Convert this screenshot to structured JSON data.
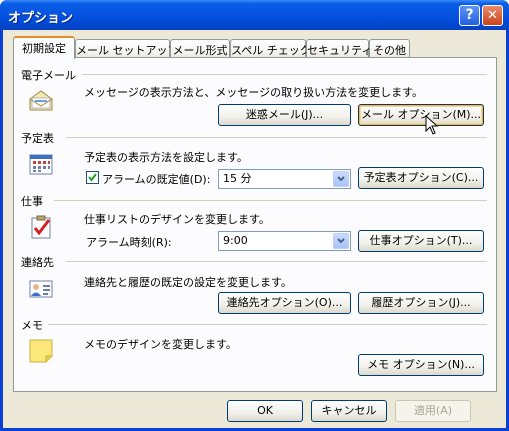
{
  "window": {
    "title": "オプション",
    "help_label": "?",
    "close_label": "✕"
  },
  "tabs": [
    {
      "label": "初期設定",
      "active": true
    },
    {
      "label": "メール セットアップ"
    },
    {
      "label": "メール形式"
    },
    {
      "label": "スペル チェック"
    },
    {
      "label": "セキュリティ"
    },
    {
      "label": "その他"
    }
  ],
  "sections": {
    "email": {
      "heading": "電子メール",
      "description": "メッセージの表示方法と、メッセージの取り扱い方法を変更します。",
      "junk_button": "迷惑メール(J)...",
      "options_button": "メール オプション(M)...",
      "icon": "envelope-icon"
    },
    "calendar": {
      "heading": "予定表",
      "description": "予定表の表示方法を設定します。",
      "reminder_label": "アラームの既定値(D):",
      "reminder_checked": true,
      "reminder_value": "15 分",
      "options_button": "予定表オプション(C)...",
      "icon": "calendar-icon"
    },
    "tasks": {
      "heading": "仕事",
      "description": "仕事リストのデザインを変更します。",
      "reminder_time_label": "アラーム時刻(R):",
      "reminder_time_value": "9:00",
      "options_button": "仕事オプション(T)...",
      "icon": "task-checklist-icon"
    },
    "contacts": {
      "heading": "連絡先",
      "description": "連絡先と履歴の既定の設定を変更します。",
      "contact_options_button": "連絡先オプション(O)...",
      "journal_options_button": "履歴オプション(J)...",
      "icon": "contact-card-icon"
    },
    "notes": {
      "heading": "メモ",
      "description": "メモのデザインを変更します。",
      "options_button": "メモ オプション(N)...",
      "icon": "sticky-note-icon"
    }
  },
  "footer": {
    "ok": "OK",
    "cancel": "キャンセル",
    "apply": "適用(A)"
  }
}
